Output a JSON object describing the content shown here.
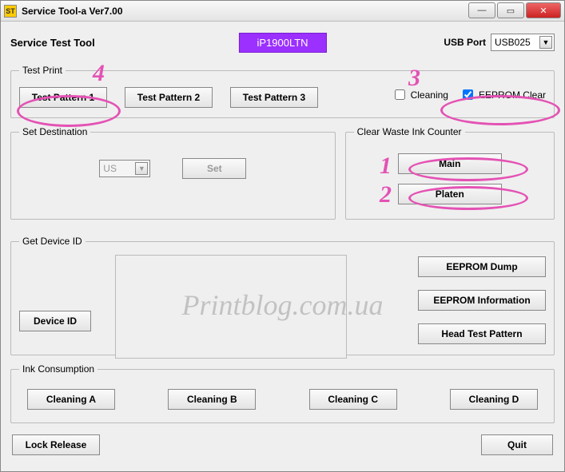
{
  "window": {
    "title": "Service Tool-a Ver7.00",
    "appicon_text": "ST"
  },
  "header": {
    "tool_label": "Service Test Tool",
    "model": "iP1900LTN",
    "usb_label": "USB Port",
    "usb_value": "USB025"
  },
  "test_print": {
    "legend": "Test Print",
    "btn1": "Test Pattern 1",
    "btn2": "Test Pattern 2",
    "btn3": "Test Pattern 3",
    "cleaning_label": "Cleaning",
    "cleaning_checked": false,
    "eeprom_clear_label": "EEPROM Clear",
    "eeprom_clear_checked": true
  },
  "set_destination": {
    "legend": "Set Destination",
    "region_value": "US",
    "set_btn": "Set"
  },
  "clear_waste": {
    "legend": "Clear Waste Ink Counter",
    "main_btn": "Main",
    "platen_btn": "Platen"
  },
  "get_device": {
    "legend": "Get Device ID",
    "device_id_btn": "Device ID",
    "eeprom_dump_btn": "EEPROM Dump",
    "eeprom_info_btn": "EEPROM Information",
    "head_test_btn": "Head Test Pattern"
  },
  "ink": {
    "legend": "Ink Consumption",
    "a": "Cleaning A",
    "b": "Cleaning B",
    "c": "Cleaning C",
    "d": "Cleaning D"
  },
  "bottom": {
    "lock_release": "Lock Release",
    "quit": "Quit"
  },
  "watermark": "Printblog.com.ua",
  "annotations": {
    "n1": "1",
    "n2": "2",
    "n3": "3",
    "n4": "4"
  }
}
